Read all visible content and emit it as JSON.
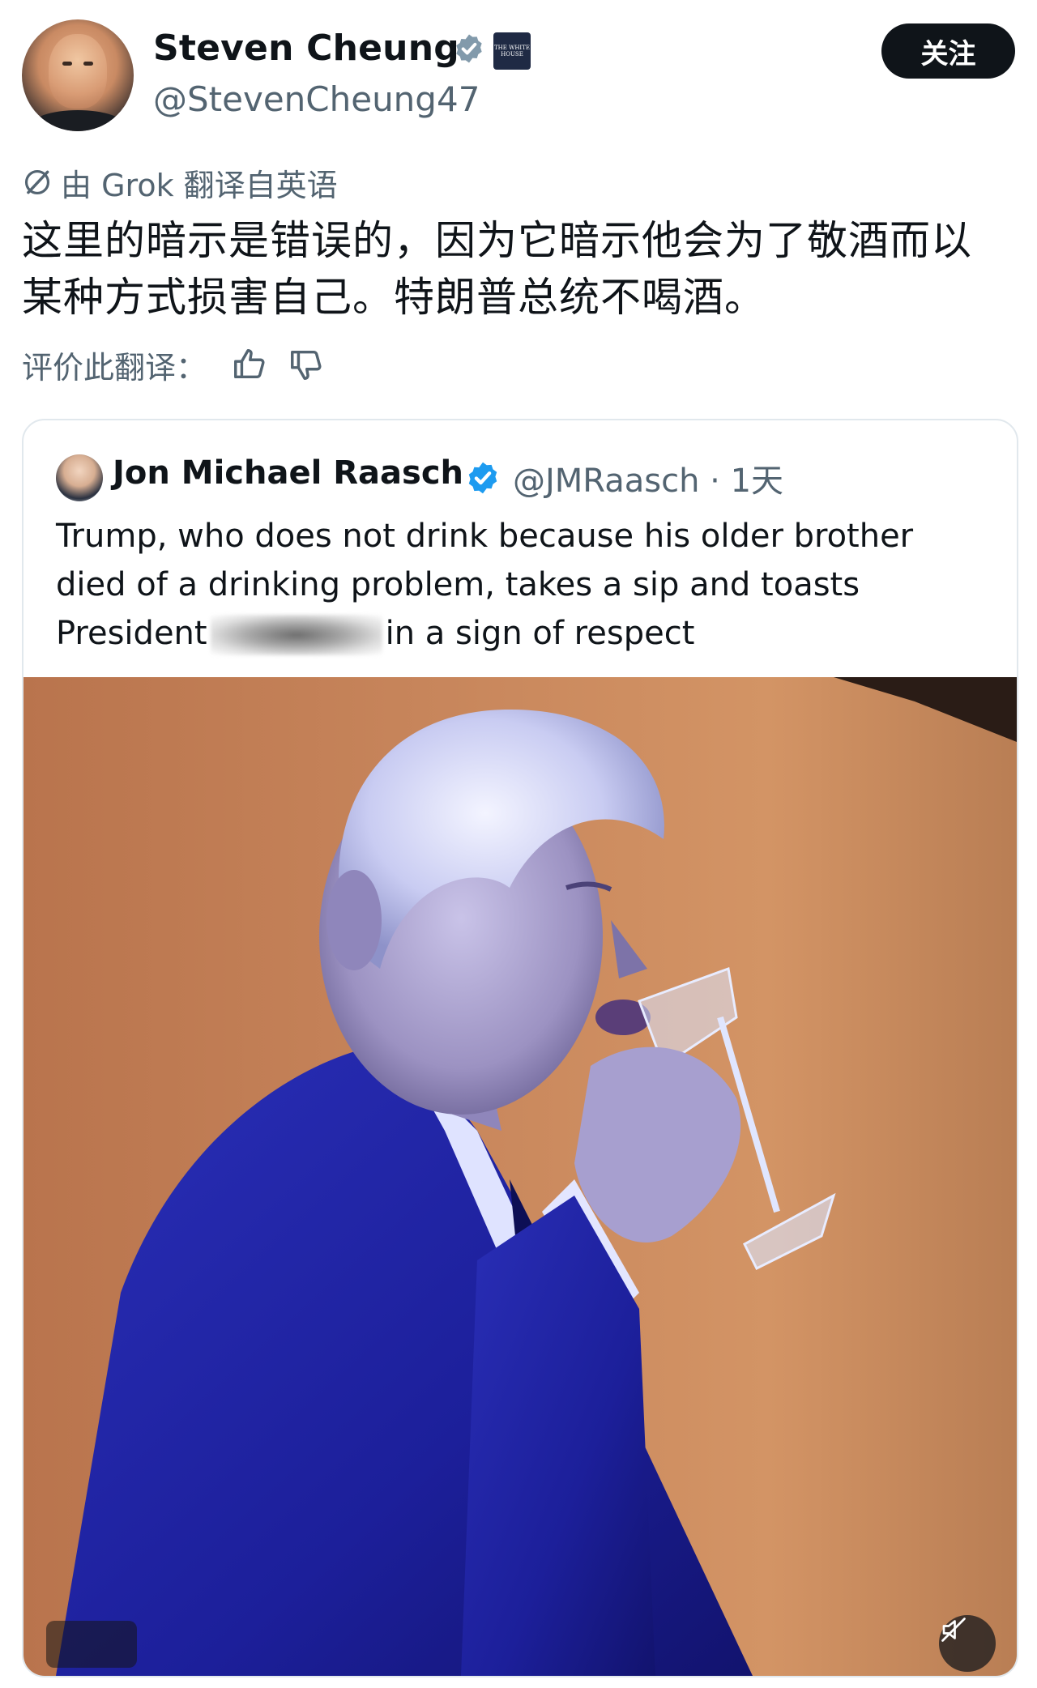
{
  "author": {
    "display_name": "Steven Cheung",
    "handle": "@StevenCheung47",
    "badge_text": "THE WHITE HOUSE",
    "follow_label": "关注"
  },
  "translation": {
    "source_note": "由 Grok 翻译自英语",
    "text": "这里的暗示是错误的，因为它暗示他会为了敬酒而以某种方式损害自己。特朗普总统不喝酒。",
    "rate_label": "评价此翻译："
  },
  "quoted_post": {
    "display_name": "Jon Michael Raasch",
    "handle_time": "@JMRaasch · 1天",
    "text_before": "Trump, who does not drink because his older brother died of a drinking problem, takes a sip and toasts President",
    "text_after": "in a sign of respect",
    "media_alt": "video-still-man-sipping-from-champagne-glass"
  },
  "colors": {
    "primary_text": "#0f1419",
    "secondary_text": "#536471",
    "verified_blue": "#1d9bf0",
    "verified_gray": "#829aab",
    "follow_button_bg": "#0f1419",
    "border": "#e1e8ed"
  }
}
